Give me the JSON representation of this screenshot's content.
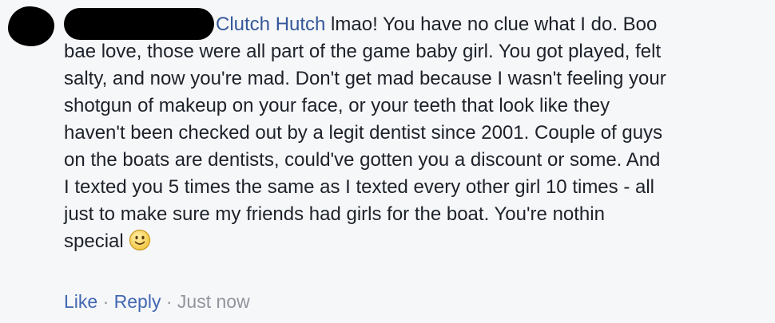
{
  "comment": {
    "author_name": "Clutch Hutch",
    "lines": [
      " lmao! You have no clue what I do. Boo",
      "bae love, those were all part of the game baby girl. You got played, felt",
      "salty, and now you're mad. Don't get mad because I wasn't feeling your",
      "shotgun of makeup on your face, or your teeth that look like they",
      "haven't been checked out by a legit dentist since 2001. Couple of guys",
      "on the boats are dentists, could've gotten you a discount or some. And",
      "I texted you 5 times the same as I texted every other girl 10 times - all",
      "just to make sure my friends had girls for the boat. You're nothin",
      "special"
    ],
    "emoji_icon": "smile-icon"
  },
  "actions": {
    "like_label": "Like",
    "separator": "·",
    "reply_label": "Reply",
    "timestamp": "Just now"
  },
  "colors": {
    "author_link": "#365899",
    "action_link": "#4267b2",
    "meta_gray": "#90949c",
    "text": "#1d2129",
    "background": "#f6f7f9"
  }
}
